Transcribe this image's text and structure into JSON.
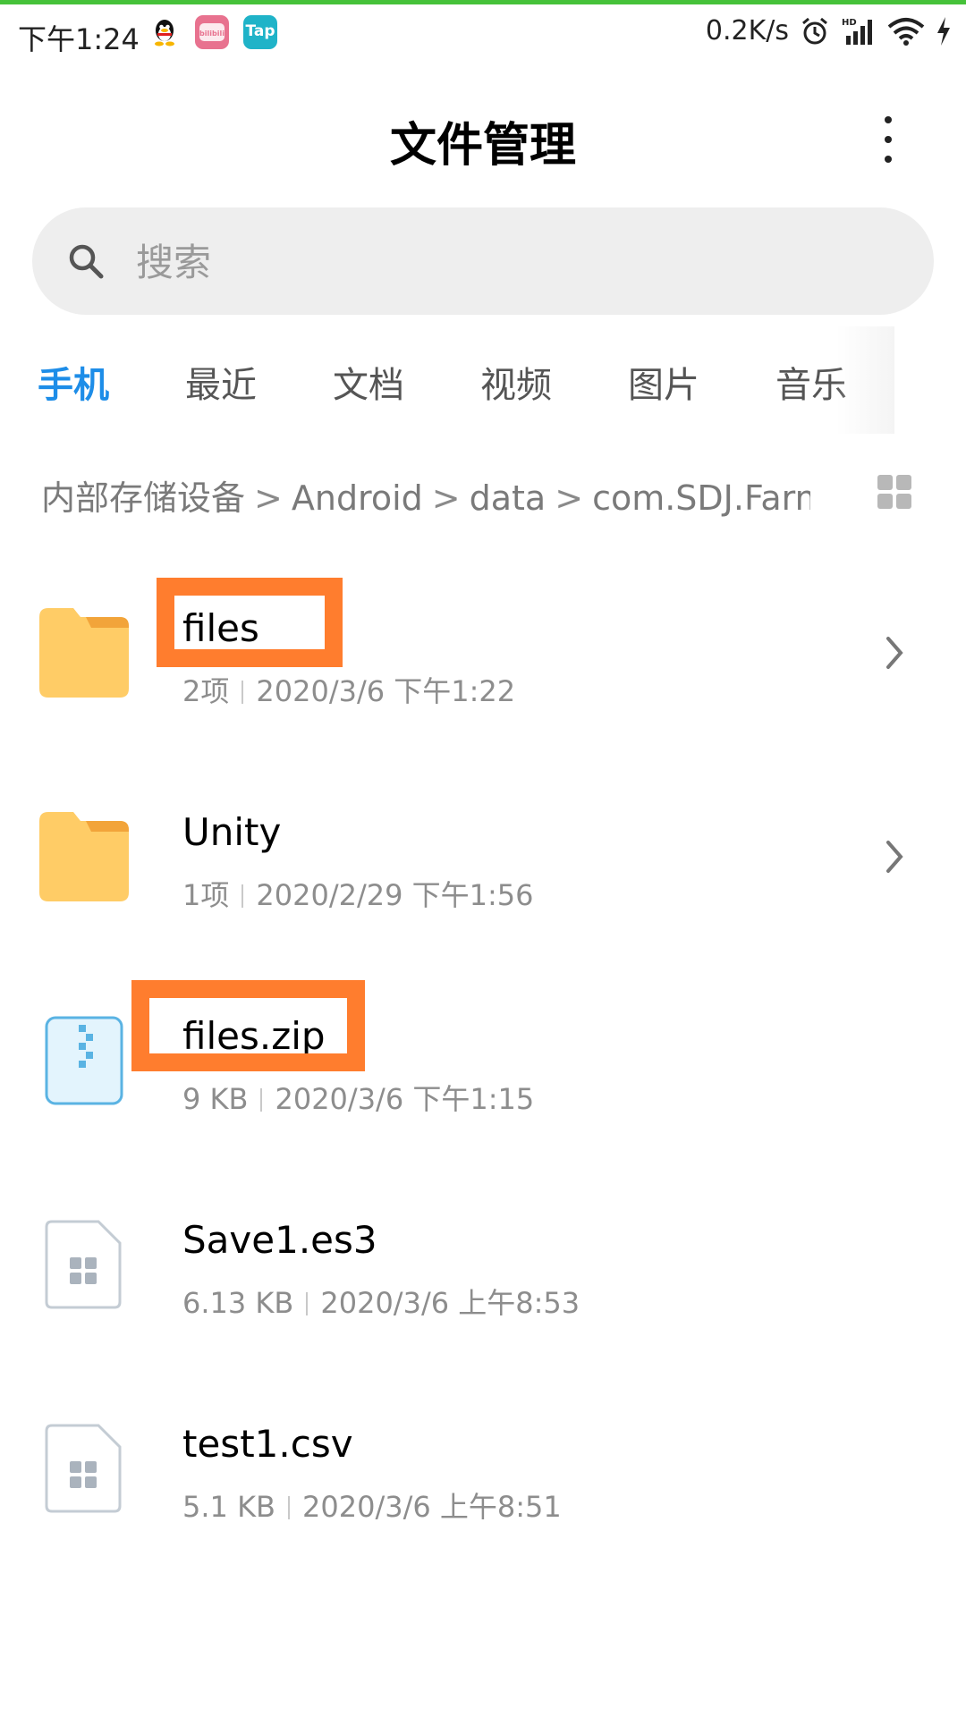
{
  "status_bar": {
    "time": "下午1:24",
    "apps": [
      {
        "icon": "qq-icon"
      },
      {
        "icon": "bilibili-icon",
        "text": "bilibili"
      },
      {
        "icon": "tap-icon",
        "text": "Tap"
      }
    ],
    "net_speed": "0.2K/s",
    "right_icons": [
      "alarm-icon",
      "hd-signal-icon",
      "wifi-icon",
      "charging-icon"
    ],
    "hd_label": "HD",
    "accent_color": "#46c23a"
  },
  "header": {
    "title": "文件管理",
    "more_icon": "more-vertical-icon"
  },
  "search": {
    "placeholder": "搜索",
    "icon": "search-icon"
  },
  "tabs": [
    {
      "label": "手机",
      "active": true
    },
    {
      "label": "最近",
      "active": false
    },
    {
      "label": "文档",
      "active": false
    },
    {
      "label": "视频",
      "active": false
    },
    {
      "label": "图片",
      "active": false
    },
    {
      "label": "音乐",
      "active": false
    }
  ],
  "active_tab_color": "#1d8de8",
  "breadcrumb": {
    "items": [
      "内部存储设备",
      "Android",
      "data",
      "com.SDJ.Farm"
    ],
    "view_toggle_icon": "grid-view-icon"
  },
  "files": [
    {
      "name": "files",
      "type": "folder",
      "count": "2项",
      "date": "2020/3/6 下午1:22",
      "highlighted": true
    },
    {
      "name": "Unity",
      "type": "folder",
      "count": "1项",
      "date": "2020/2/29 下午1:56",
      "highlighted": false
    },
    {
      "name": "files.zip",
      "type": "zip",
      "size": "9 KB",
      "date": "2020/3/6 下午1:15",
      "highlighted": true
    },
    {
      "name": "Save1.es3",
      "type": "unknown",
      "size": "6.13 KB",
      "date": "2020/3/6 上午8:53",
      "highlighted": false
    },
    {
      "name": "test1.csv",
      "type": "unknown",
      "size": "5.1 KB",
      "date": "2020/3/6 上午8:51",
      "highlighted": false
    }
  ],
  "highlight_color": "#ff7d2e",
  "folder_color": "#ffcc66"
}
